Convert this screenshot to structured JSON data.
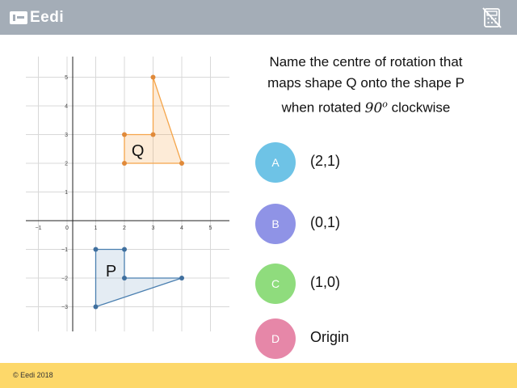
{
  "header": {
    "logo_text": "Eedi",
    "calculator_icon": "calculator-disabled-icon",
    "background": "#a4adb7"
  },
  "question": {
    "line1": "Name the centre of rotation that",
    "line2": "maps shape Q onto the shape P",
    "line3_pre": "when rotated",
    "angle": "90",
    "angle_sup": "o",
    "line3_post": "clockwise"
  },
  "graph": {
    "x_ticks": [
      "−1",
      "0",
      "1",
      "2",
      "3",
      "4",
      "5"
    ],
    "y_ticks": [
      "5",
      "4",
      "3",
      "2",
      "1",
      "−1",
      "−2",
      "−3"
    ],
    "shape_q_label": "Q",
    "shape_p_label": "P",
    "shape_q_vertices": [
      [
        2,
        3
      ],
      [
        3,
        3
      ],
      [
        3,
        5
      ],
      [
        4,
        2
      ],
      [
        2,
        2
      ]
    ],
    "shape_p_vertices": [
      [
        1,
        -1
      ],
      [
        2,
        -1
      ],
      [
        2,
        -2
      ],
      [
        4,
        -2
      ],
      [
        1,
        -3
      ]
    ],
    "shape_q_color": "#f5a54a",
    "shape_p_color": "#4a7fb0"
  },
  "options": [
    {
      "letter": "A",
      "text": "(2,1)",
      "color": "#6ec3e6"
    },
    {
      "letter": "B",
      "text": "(0,1)",
      "color": "#8f93e6"
    },
    {
      "letter": "C",
      "text": "(1,0)",
      "color": "#8fdc7d"
    },
    {
      "letter": "D",
      "text": "Origin",
      "color": "#e687a8"
    }
  ],
  "footer": {
    "copyright": "© Eedi 2018",
    "background": "#fdd86a"
  }
}
